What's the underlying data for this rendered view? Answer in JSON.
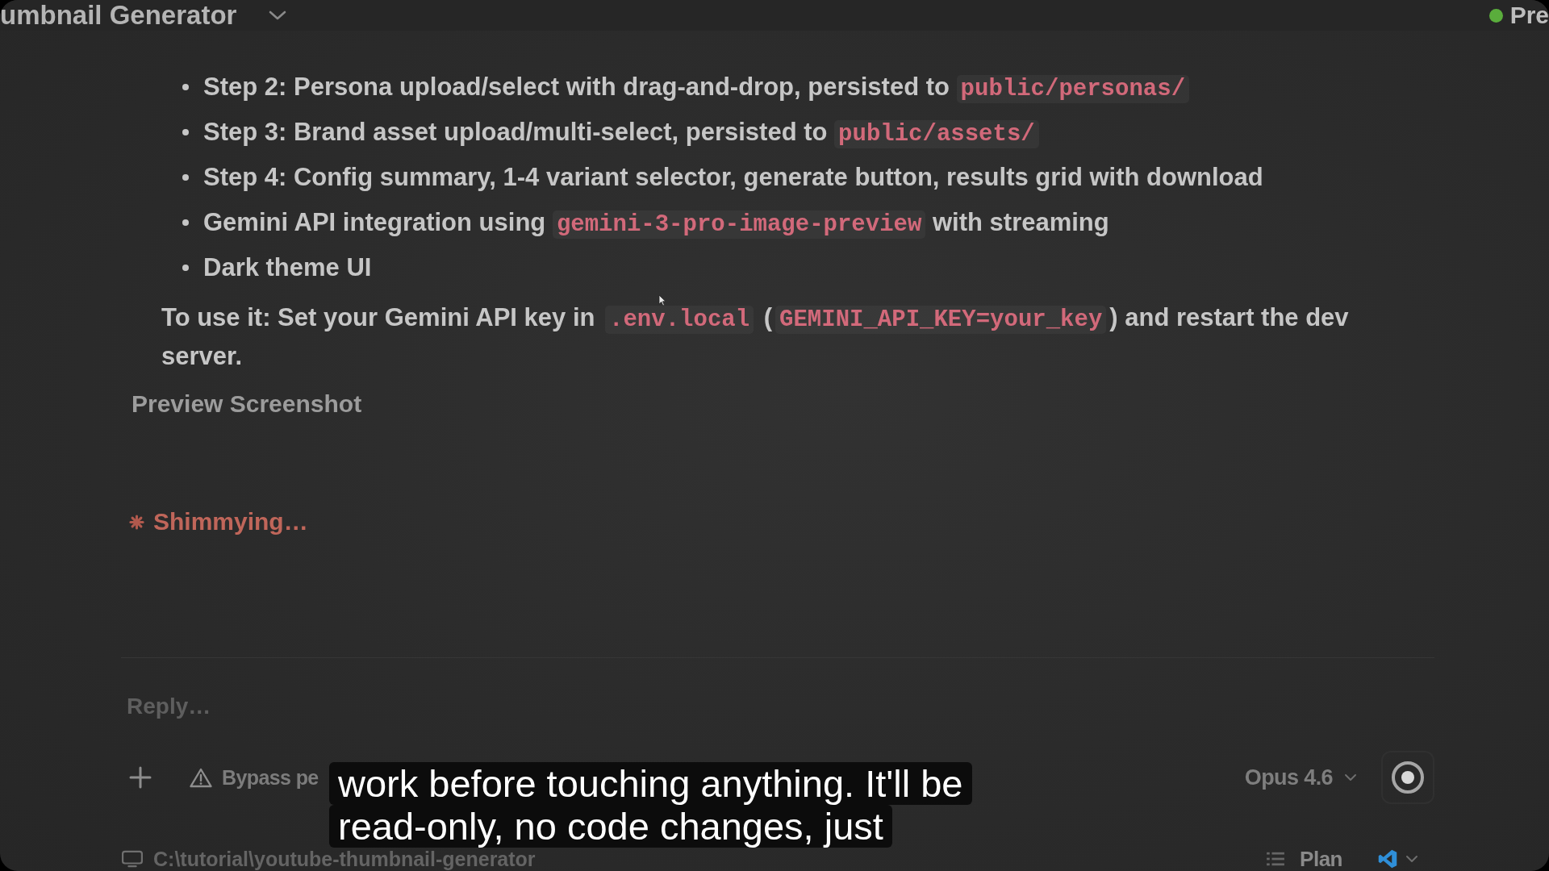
{
  "top_bar": {
    "title": "umbnail Generator",
    "preview": {
      "label": "Pre",
      "running": true
    }
  },
  "message": {
    "bullets": [
      {
        "segments": [
          {
            "kind": "text",
            "text": "Step 2: Persona upload/select with drag-and-drop, persisted to "
          },
          {
            "kind": "code",
            "text": "public/personas/"
          }
        ]
      },
      {
        "segments": [
          {
            "kind": "text",
            "text": "Step 3: Brand asset upload/multi-select, persisted to "
          },
          {
            "kind": "code",
            "text": "public/assets/"
          }
        ]
      },
      {
        "segments": [
          {
            "kind": "text",
            "text": "Step 4: Config summary, 1-4 variant selector, generate button, results grid with download"
          }
        ]
      },
      {
        "segments": [
          {
            "kind": "text",
            "text": "Gemini API integration using "
          },
          {
            "kind": "code",
            "text": "gemini-3-pro-image-preview"
          },
          {
            "kind": "text",
            "text": " with streaming"
          }
        ]
      },
      {
        "segments": [
          {
            "kind": "text",
            "text": "Dark theme UI"
          }
        ]
      }
    ],
    "note": {
      "segments": [
        {
          "kind": "text",
          "text": "To use it: Set your Gemini API key in "
        },
        {
          "kind": "code",
          "text": ".env.local"
        },
        {
          "kind": "text",
          "text": " ("
        },
        {
          "kind": "code",
          "text": "GEMINI_API_KEY=your_key"
        },
        {
          "kind": "text",
          "text": ") and restart the dev server."
        }
      ]
    },
    "heading": "Preview Screenshot"
  },
  "status": {
    "label": "Shimmying…"
  },
  "composer": {
    "placeholder": "Reply…",
    "mode": "Bypass pe",
    "model": "Opus 4.6"
  },
  "footer": {
    "path": "C:\\tutorial\\youtube-thumbnail-generator",
    "plan": "Plan"
  },
  "captions": [
    "work before touching anything. It'll be",
    "read-only, no code changes, just"
  ]
}
